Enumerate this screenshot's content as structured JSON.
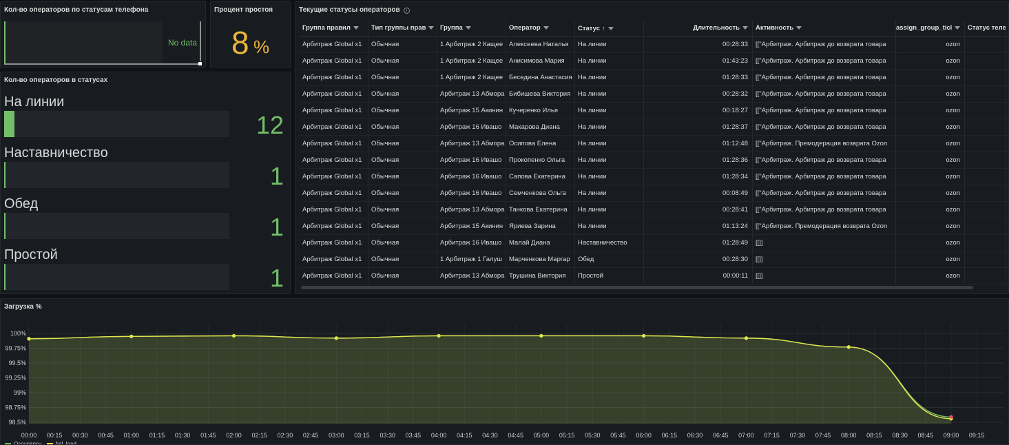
{
  "phone_panel": {
    "title": "Кол-во операторов по статусам телефона",
    "no_data": "No data"
  },
  "idle_panel": {
    "title": "Процент простоя",
    "value": "8",
    "unit": "%"
  },
  "status_panel": {
    "title": "Кол-во операторов в статусах",
    "rows": [
      {
        "label": "На линии",
        "value": "12",
        "fraction": 0.045
      },
      {
        "label": "Наставничество",
        "value": "1",
        "fraction": 0.004
      },
      {
        "label": "Обед",
        "value": "1",
        "fraction": 0.004
      },
      {
        "label": "Простой",
        "value": "1",
        "fraction": 0.004
      }
    ]
  },
  "table_panel": {
    "title": "Текущие статусы операторов",
    "info_icon": "info-icon",
    "columns": [
      "Группа правил",
      "Тип группы прав",
      "Группа",
      "Оператор",
      "Статус",
      "Длительность",
      "Активность",
      "assign_group_ticl",
      "Статус теле"
    ],
    "sort_indicator": "↑",
    "rows": [
      [
        "Арбитраж Global x1",
        "Обычная",
        "1 Арбитраж 2 Кащее",
        "Алексеева Наталья",
        "На линии",
        "00:28:33",
        "[[\"Арбитраж. Арбитраж до возврата товара",
        "ozon",
        ""
      ],
      [
        "Арбитраж Global x1",
        "Обычная",
        "1 Арбитраж 2 Кащее",
        "Анисимова Мария",
        "На линии",
        "01:43:23",
        "[[\"Арбитраж. Арбитраж до возврата товара",
        "ozon",
        ""
      ],
      [
        "Арбитраж Global x1",
        "Обычная",
        "1 Арбитраж 2 Кащее",
        "Беседина Анастасия",
        "На линии",
        "01:28:33",
        "[[\"Арбитраж. Арбитраж до возврата товара",
        "ozon",
        ""
      ],
      [
        "Арбитраж Global x1",
        "Обычная",
        "Арбитраж 13 Абмора",
        "Бибишева Виктория",
        "На линии",
        "00:28:32",
        "[[\"Арбитраж. Арбитраж до возврата товара",
        "ozon",
        ""
      ],
      [
        "Арбитраж Global x1",
        "Обычная",
        "Арбитраж 15 Акинин",
        "Кучеренко Илья",
        "На линии",
        "00:18:27",
        "[[\"Арбитраж. Арбитраж до возврата товара",
        "ozon",
        ""
      ],
      [
        "Арбитраж Global x1",
        "Обычная",
        "Арбитраж 16 Ивашо",
        "Макарова Диана",
        "На линии",
        "01:28:37",
        "[[\"Арбитраж. Арбитраж до возврата товара",
        "ozon",
        ""
      ],
      [
        "Арбитраж Global x1",
        "Обычная",
        "Арбитраж 13 Абмора",
        "Осипова Елена",
        "На линии",
        "01:12:48",
        "[[\"Арбитраж. Премодерация возврата Ozon",
        "ozon",
        ""
      ],
      [
        "Арбитраж Global x1",
        "Обычная",
        "Арбитраж 16 Ивашо",
        "Прокопенко Ольга",
        "На линии",
        "01:28:36",
        "[[\"Арбитраж. Арбитраж до возврата товара",
        "ozon",
        ""
      ],
      [
        "Арбитраж Global x1",
        "Обычная",
        "Арбитраж 16 Ивашо",
        "Сапова Екатерина",
        "На линии",
        "01:28:34",
        "[[\"Арбитраж. Арбитраж до возврата товара",
        "ozon",
        ""
      ],
      [
        "Арбитраж Global x1",
        "Обычная",
        "Арбитраж 16 Ивашо",
        "Семченкова Ольга",
        "На линии",
        "00:08:49",
        "[[\"Арбитраж. Арбитраж до возврата товара",
        "ozon",
        ""
      ],
      [
        "Арбитраж Global x1",
        "Обычная",
        "Арбитраж 13 Абмора",
        "Танкова Екатерина",
        "На линии",
        "00:28:41",
        "[[\"Арбитраж. Арбитраж до возврата товара",
        "ozon",
        ""
      ],
      [
        "Арбитраж Global x1",
        "Обычная",
        "Арбитраж 15 Акинин",
        "Яриева Зарина",
        "На линии",
        "01:13:24",
        "[[\"Арбитраж. Премодерация возврата Ozon",
        "ozon",
        ""
      ],
      [
        "Арбитраж Global x1",
        "Обычная",
        "Арбитраж 16 Ивашо",
        "Малай Диана",
        "Наставничество",
        "01:28:49",
        "[[]]",
        "ozon",
        ""
      ],
      [
        "Арбитраж Global x1",
        "Обычная",
        "1 Арбитраж 1 Галуш",
        "Марченкова Маргар",
        "Обед",
        "00:28:30",
        "[[]]",
        "ozon",
        ""
      ],
      [
        "Арбитраж Global x1",
        "Обычная",
        "Арбитраж 13 Абмора",
        "Трушина Виктория",
        "Простой",
        "00:00:11",
        "[[]]",
        "ozon",
        ""
      ]
    ]
  },
  "chart_panel": {
    "title": "Загрузка %"
  },
  "colors": {
    "green": "#73bf69",
    "yellow": "#eab839",
    "red": "#f2495c",
    "line_yellow": "#e6e64c"
  },
  "chart_data": {
    "type": "area",
    "title": "Загрузка %",
    "xlabel": "",
    "ylabel": "",
    "x_ticks": [
      "00:00",
      "00:15",
      "00:30",
      "00:45",
      "01:00",
      "01:15",
      "01:30",
      "01:45",
      "02:00",
      "02:15",
      "02:30",
      "02:45",
      "03:00",
      "03:15",
      "03:30",
      "03:45",
      "04:00",
      "04:15",
      "04:30",
      "04:45",
      "05:00",
      "05:15",
      "05:30",
      "05:45",
      "06:00",
      "06:15",
      "06:30",
      "06:45",
      "07:00",
      "07:15",
      "07:30",
      "07:45",
      "08:00",
      "08:15",
      "08:30",
      "08:45",
      "09:00",
      "09:15"
    ],
    "y_ticks": [
      "100%",
      "99.75%",
      "99.5%",
      "99.25%",
      "99%",
      "98.75%",
      "98.5%"
    ],
    "ylim": [
      98.45,
      100.1
    ],
    "x_hours": [
      0,
      1,
      2,
      3,
      4,
      5,
      6,
      7,
      8,
      9
    ],
    "series": [
      {
        "name": "Occupancy",
        "color": "#73bf69",
        "values": [
          99.91,
          99.95,
          99.96,
          99.92,
          99.96,
          99.96,
          99.96,
          99.92,
          99.77,
          98.59
        ]
      },
      {
        "name": "full_load",
        "color": "#e6e64c",
        "values": [
          99.91,
          99.95,
          99.96,
          99.92,
          99.96,
          99.96,
          99.96,
          99.92,
          99.77,
          98.56
        ]
      }
    ],
    "legend_position": "bottom-left",
    "grid": true
  }
}
